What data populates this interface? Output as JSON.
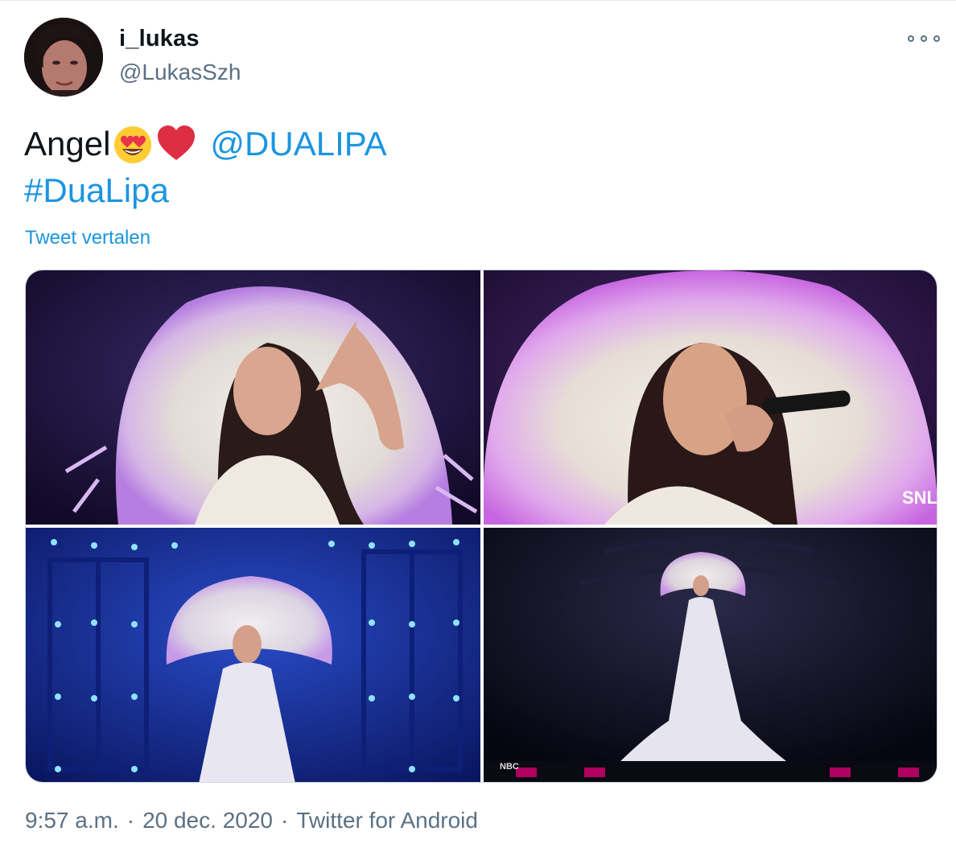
{
  "user": {
    "display_name": "i_lukas",
    "handle": "@LukasSzh"
  },
  "menu_icon": "more-horizontal-icon",
  "tweet": {
    "text_prefix": "Angel",
    "emojis": [
      "heart-eyes-emoji",
      "red-heart-emoji"
    ],
    "mention": "@DUALIPA",
    "hashtag": "#DuaLipa",
    "translate_label": "Tweet vertalen"
  },
  "media": {
    "photos": [
      {
        "name": "dua-lipa-feather-hat-pose"
      },
      {
        "name": "dua-lipa-singing-microphone",
        "overlay": "SNL"
      },
      {
        "name": "dua-lipa-stage-blue-lights"
      },
      {
        "name": "dua-lipa-stage-full-length",
        "overlay": "NBC"
      }
    ]
  },
  "meta": {
    "time": "9:57 a.m.",
    "separator": "·",
    "date": "20 dec. 2020",
    "source": "Twitter for Android"
  },
  "colors": {
    "link": "#1b95e0",
    "secondary_text": "#5b7083",
    "primary_text": "#0f1419"
  }
}
